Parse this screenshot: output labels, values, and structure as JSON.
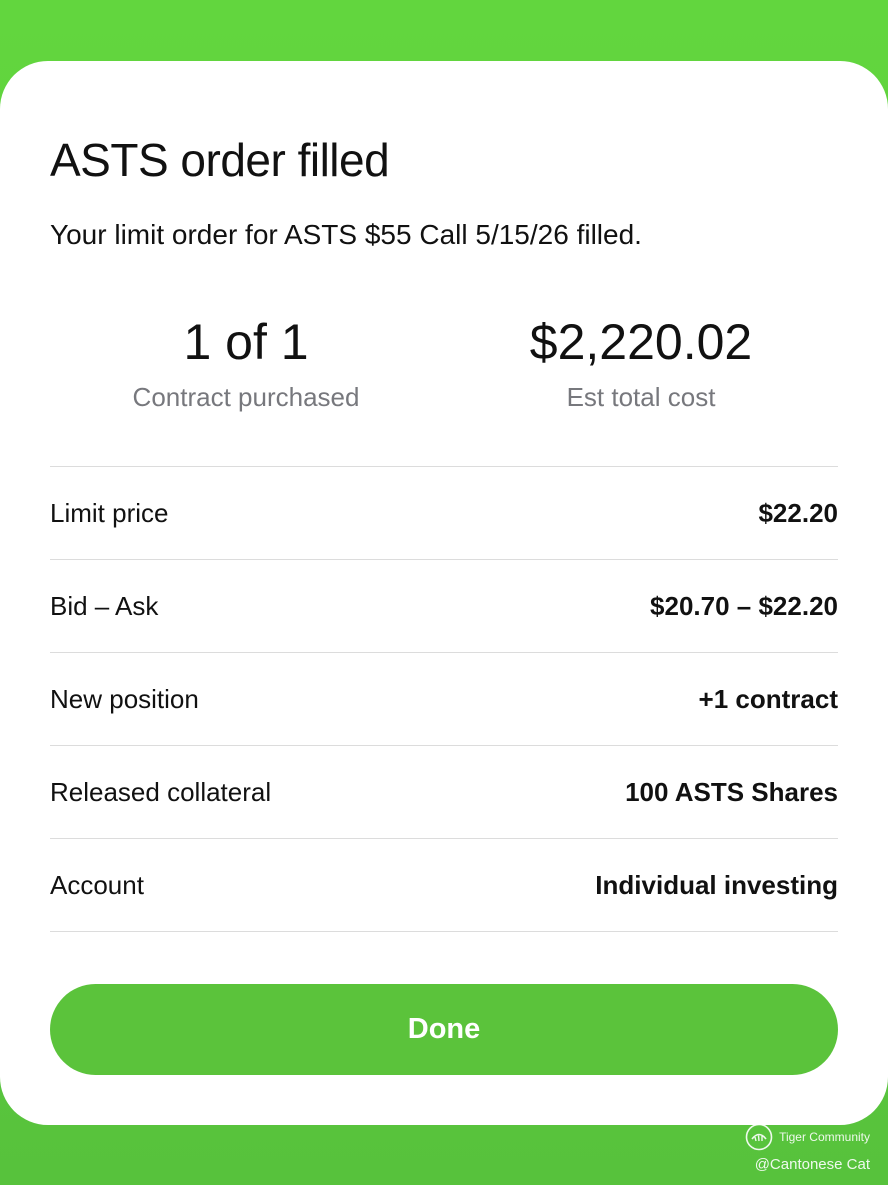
{
  "dialog": {
    "title": "ASTS order filled",
    "message": "Your limit order for ASTS $55 Call 5/15/26 filled."
  },
  "stats": {
    "contracts": {
      "value": "1 of 1",
      "label": "Contract purchased"
    },
    "cost": {
      "value": "$2,220.02",
      "label": "Est total cost"
    }
  },
  "details": [
    {
      "label": "Limit price",
      "value": "$22.20"
    },
    {
      "label": "Bid – Ask",
      "value": "$20.70 – $22.20"
    },
    {
      "label": "New position",
      "value": "+1 contract"
    },
    {
      "label": "Released collateral",
      "value": "100 ASTS Shares"
    },
    {
      "label": "Account",
      "value": "Individual investing"
    }
  ],
  "actions": {
    "done_label": "Done"
  },
  "watermark": {
    "brand": "Tiger Community",
    "handle": "@Cantonese Cat",
    "icon": "tiger-logo-icon"
  },
  "colors": {
    "brand_green": "#5bc33b",
    "background_green": "#62d63e",
    "muted_text": "#77787d"
  }
}
